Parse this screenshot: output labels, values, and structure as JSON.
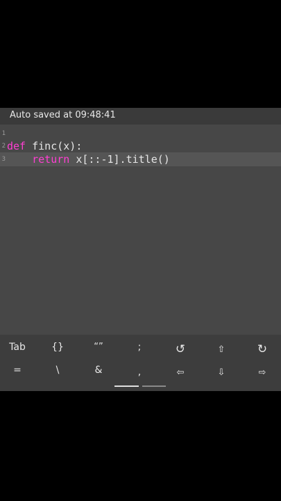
{
  "status": {
    "text": "Auto saved at 09:48:41"
  },
  "editor": {
    "lines": [
      {
        "number": "1",
        "keyword": "",
        "code": ""
      },
      {
        "number": "2",
        "keyword": "def",
        "code": " finc(x):"
      },
      {
        "number": "3",
        "keyword": "    return",
        "code": " x[::-1].title()"
      }
    ]
  },
  "keys": {
    "row1": [
      "Tab",
      "{}",
      "“”",
      ";",
      "↺",
      "⇧",
      "↻"
    ],
    "row2": [
      "=",
      "\\",
      "&",
      ",",
      "⇦",
      "⇩",
      "⇨"
    ]
  },
  "colors": {
    "keyword": "#ff3fd2",
    "background": "#474747"
  }
}
